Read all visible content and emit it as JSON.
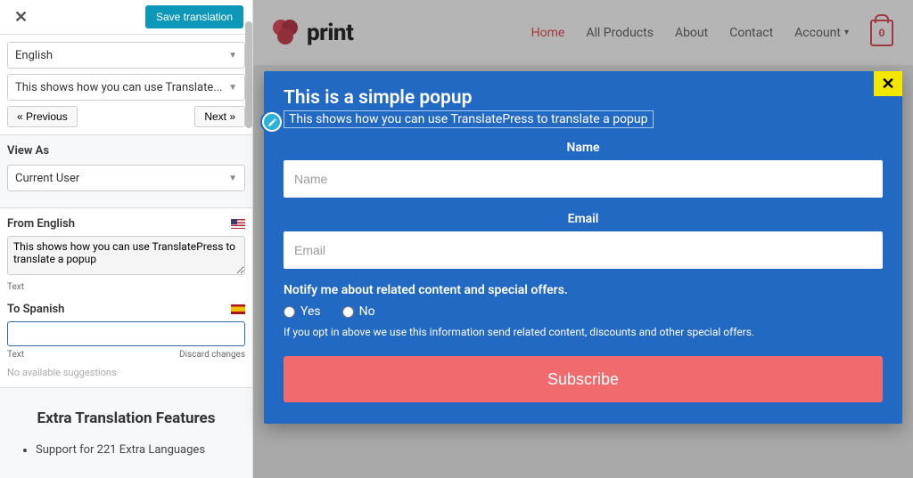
{
  "panel": {
    "save_label": "Save translation",
    "lang_select": "English",
    "string_select": "This shows how you can use Translate...",
    "prev_label": "« Previous",
    "next_label": "Next »",
    "view_as_label": "View As",
    "view_as_value": "Current User",
    "from_label": "From English",
    "from_text": "This shows how you can use TranslatePress to translate a popup",
    "text_meta": "Text",
    "to_label": "To Spanish",
    "to_value": "",
    "discard_label": "Discard changes",
    "no_suggestions": "No available suggestions"
  },
  "extra": {
    "title": "Extra Translation Features",
    "items": [
      "Support for 221 Extra Languages"
    ]
  },
  "site": {
    "brand": "print",
    "nav": {
      "home": "Home",
      "all_products": "All Products",
      "about": "About",
      "contact": "Contact",
      "account": "Account"
    },
    "cart_count": "0"
  },
  "popup": {
    "title": "This is a simple popup",
    "subtitle": "This shows how you can use TranslatePress to translate a popup",
    "name_label": "Name",
    "name_ph": "Name",
    "email_label": "Email",
    "email_ph": "Email",
    "notify_label": "Notify me about related content and special offers.",
    "yes": "Yes",
    "no": "No",
    "optin_note": "If you opt in above we use this information send related content, discounts and other special offers.",
    "subscribe": "Subscribe"
  }
}
